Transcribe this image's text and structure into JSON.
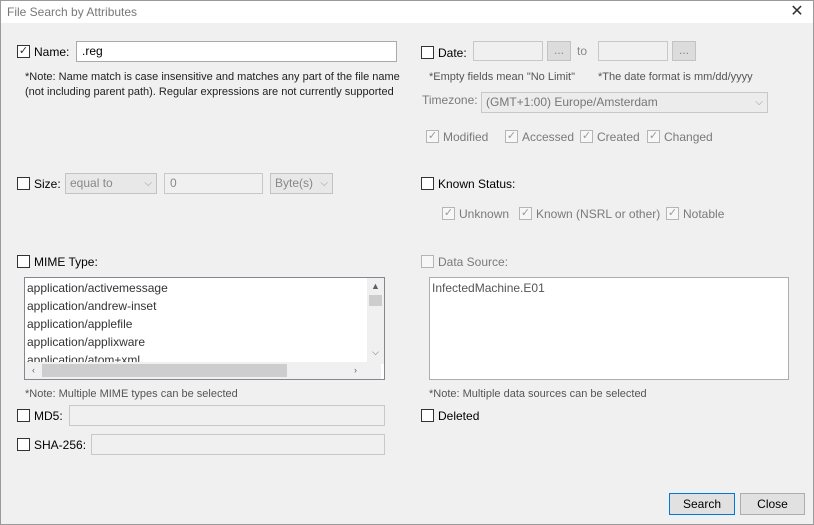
{
  "window": {
    "title": "File Search by Attributes",
    "close_glyph": "✕"
  },
  "name": {
    "label": "Name:",
    "checked": true,
    "value": ".reg",
    "note": "*Note: Name match is case insensitive and matches any part of the file name (not including parent path). Regular expressions are not currently supported"
  },
  "date": {
    "label": "Date:",
    "from_value": "",
    "browse_label": "...",
    "to_label": "to",
    "to_value": "",
    "browse2_label": "...",
    "empty_note": "*Empty fields mean \"No Limit\"",
    "format_note": "*The date format is mm/dd/yyyy",
    "timezone_label": "Timezone:",
    "timezone_value": "(GMT+1:00) Europe/Amsterdam",
    "modified": "Modified",
    "accessed": "Accessed",
    "created": "Created",
    "changed": "Changed"
  },
  "size": {
    "label": "Size:",
    "operator": "equal to",
    "value": "0",
    "unit": "Byte(s)"
  },
  "known_status": {
    "label": "Known Status:",
    "unknown": "Unknown",
    "known": "Known (NSRL or other)",
    "notable": "Notable"
  },
  "mime": {
    "label": "MIME Type:",
    "items": [
      "application/activemessage",
      "application/andrew-inset",
      "application/applefile",
      "application/applixware",
      "application/atom+xml"
    ],
    "note": "*Note: Multiple MIME types can be selected"
  },
  "data_source": {
    "label": "Data Source:",
    "items": [
      "InfectedMachine.E01"
    ],
    "note": "*Note: Multiple data sources can be selected"
  },
  "md5": {
    "label": "MD5:",
    "value": ""
  },
  "sha256": {
    "label": "SHA-256:",
    "value": ""
  },
  "deleted": {
    "label": "Deleted"
  },
  "buttons": {
    "search": "Search",
    "close": "Close"
  },
  "glyphs": {
    "check": "✓",
    "chevron_down": "⌵",
    "scroll_up": "▲",
    "scroll_down": "⌵",
    "scroll_left": "‹",
    "scroll_right": "›"
  }
}
